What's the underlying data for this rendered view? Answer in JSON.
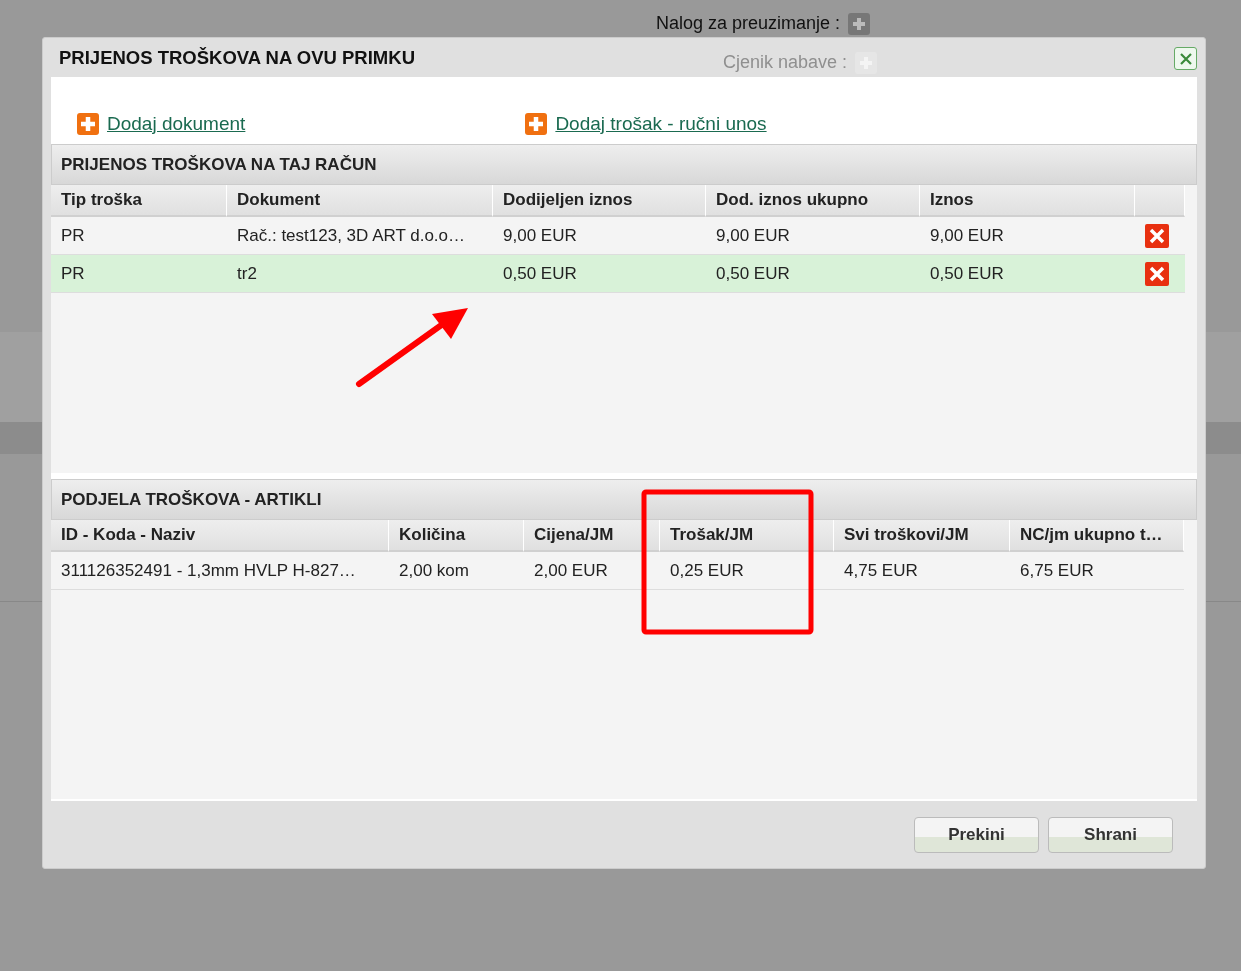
{
  "background": {
    "labels": [
      "Nalog za preuzimanje :",
      "Cjenik nabave :"
    ]
  },
  "dialog": {
    "title": "PRIJENOS TROŠKOVA NA OVU PRIMKU",
    "links": [
      "Dodaj dokument",
      "Dodaj trošak - ručni unos"
    ],
    "cost_table": {
      "title": "PRIJENOS TROŠKOVA NA TAJ RAČUN",
      "columns": [
        "Tip troška",
        "Dokument",
        "Dodijeljen iznos",
        "Dod. iznos ukupno",
        "Iznos"
      ],
      "rows": [
        {
          "cells": [
            "PR",
            "Rač.: test123, 3D ART d.o.o…",
            "9,00 EUR",
            "9,00 EUR",
            "9,00 EUR"
          ],
          "selected": false
        },
        {
          "cells": [
            "PR",
            "tr2",
            "0,50 EUR",
            "0,50 EUR",
            "0,50 EUR"
          ],
          "selected": true
        }
      ]
    },
    "items_table": {
      "title": "PODJELA TROŠKOVA - ARTIKLI",
      "columns": [
        "ID - Koda - Naziv",
        "Količina",
        "Cijena/JM",
        "Trošak/JM",
        "Svi troškovi/JM",
        "NC/jm ukupno t…"
      ],
      "rows": [
        {
          "cells": [
            "311126352491 - 1,3mm HVLP H-827…",
            "2,00 kom",
            "2,00 EUR",
            "0,25 EUR",
            "4,75 EUR",
            "6,75 EUR"
          ],
          "selected": false
        }
      ]
    },
    "buttons": [
      "Prekini",
      "Shrani"
    ]
  }
}
